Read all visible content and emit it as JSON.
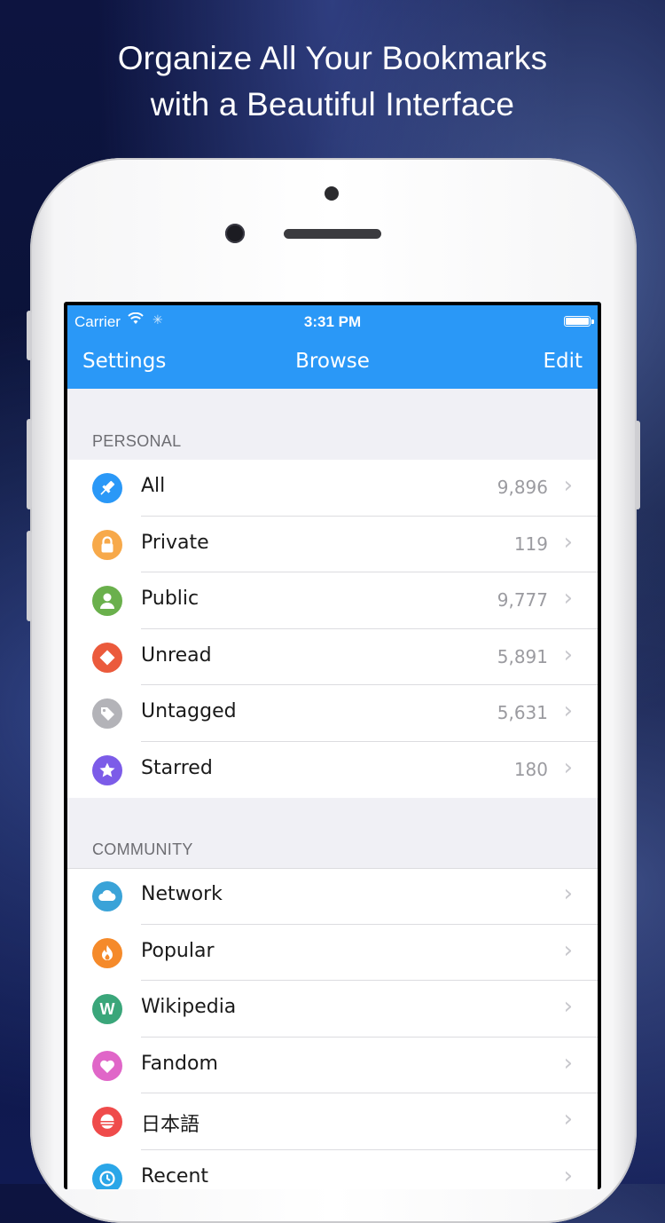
{
  "headline": {
    "line1": "Organize All Your Bookmarks",
    "line2": "with a Beautiful Interface"
  },
  "status_bar": {
    "carrier": "Carrier",
    "time": "3:31 PM"
  },
  "nav": {
    "left": "Settings",
    "title": "Browse",
    "right": "Edit"
  },
  "sections": {
    "personal": {
      "header": "PERSONAL",
      "items": [
        {
          "label": "All",
          "count": "9,896",
          "icon": "pin-icon",
          "color": "#2a98f7",
          "glyph": "✎"
        },
        {
          "label": "Private",
          "count": "119",
          "icon": "lock-icon",
          "color": "#f7a94a",
          "glyph": "🔒"
        },
        {
          "label": "Public",
          "count": "9,777",
          "icon": "person-icon",
          "color": "#6ab04c",
          "glyph": "●"
        },
        {
          "label": "Unread",
          "count": "5,891",
          "icon": "diamond-icon",
          "color": "#eb5a3c",
          "glyph": "◆"
        },
        {
          "label": "Untagged",
          "count": "5,631",
          "icon": "tag-icon",
          "color": "#b3b3b8",
          "glyph": "◈"
        },
        {
          "label": "Starred",
          "count": "180",
          "icon": "star-icon",
          "color": "#7c5ce8",
          "glyph": "★"
        }
      ]
    },
    "community": {
      "header": "COMMUNITY",
      "items": [
        {
          "label": "Network",
          "count": "",
          "icon": "cloud-icon",
          "color": "#3aa3d8",
          "glyph": "☁"
        },
        {
          "label": "Popular",
          "count": "",
          "icon": "flame-icon",
          "color": "#f58a2a",
          "glyph": "♨"
        },
        {
          "label": "Wikipedia",
          "count": "",
          "icon": "wikipedia-icon",
          "color": "#3aa67a",
          "glyph": "W"
        },
        {
          "label": "Fandom",
          "count": "",
          "icon": "heart-icon",
          "color": "#e066c8",
          "glyph": "♥"
        },
        {
          "label": "日本語",
          "count": "",
          "icon": "japan-icon",
          "color": "#ef4b4b",
          "glyph": "≡"
        },
        {
          "label": "Recent",
          "count": "",
          "icon": "clock-icon",
          "color": "#2aa6e8",
          "glyph": "◷"
        }
      ]
    }
  }
}
